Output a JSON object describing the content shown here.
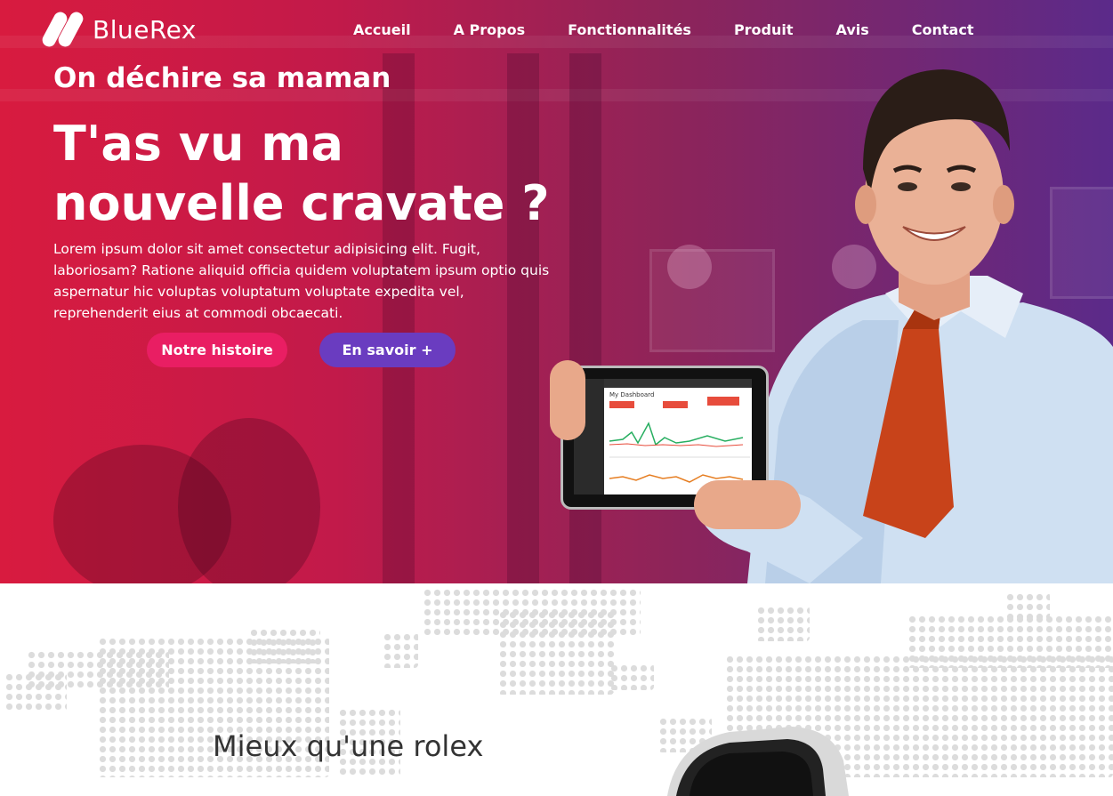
{
  "brand": {
    "name": "BlueRex"
  },
  "nav": {
    "items": [
      "Accueil",
      "A Propos",
      "Fonctionnalités",
      "Produit",
      "Avis",
      "Contact"
    ]
  },
  "hero": {
    "subtitle": "On déchire sa maman",
    "headline": "T'as vu ma nouvelle cravate ?",
    "body": "Lorem ipsum dolor sit amet consectetur adipisicing elit. Fugit, laboriosam? Ratione aliquid officia quidem voluptatem ipsum optio quis aspernatur hic voluptas voluptatum voluptate expedita vel, reprehenderit eius at commodi obcaecati.",
    "primary_button": "Notre histoire",
    "secondary_button": "En savoir +",
    "tablet_screen_title": "My Dashboard"
  },
  "section": {
    "title": "Mieux qu'une rolex"
  },
  "colors": {
    "primary_button": "#e91e63",
    "secondary_button": "#6a3cc0",
    "hero_gradient_start": "#d81b3f",
    "hero_gradient_end": "#5b2a8a"
  }
}
